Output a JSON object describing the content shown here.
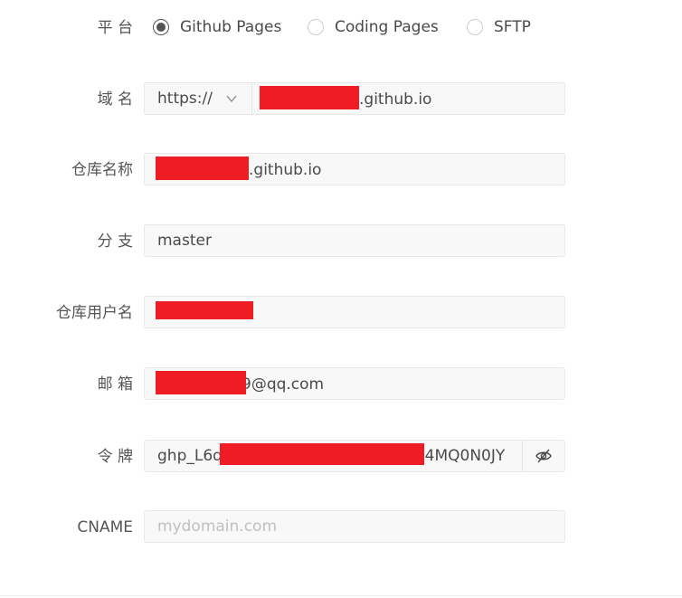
{
  "platform": {
    "label": "平 台",
    "options": [
      {
        "label": "Github Pages",
        "selected": true
      },
      {
        "label": "Coding Pages",
        "selected": false
      },
      {
        "label": "SFTP",
        "selected": false
      }
    ]
  },
  "domain": {
    "label": "域 名",
    "protocol": "https://",
    "suffix": ".github.io"
  },
  "repo_name": {
    "label": "仓库名称",
    "suffix": ".github.io"
  },
  "branch": {
    "label": "分 支",
    "value": "master"
  },
  "repo_user": {
    "label": "仓库用户名"
  },
  "email": {
    "label": "邮 箱",
    "suffix": "9@qq.com"
  },
  "token": {
    "label": "令 牌",
    "prefix": "ghp_L6q",
    "suffix": "l4MQ0N0JY"
  },
  "cname": {
    "label": "CNAME",
    "placeholder": "mydomain.com"
  },
  "colors": {
    "redaction": "#f01c24",
    "field_bg": "#f8f8f8",
    "border": "#e7e7e7",
    "text": "#4a4a4a"
  },
  "icons": {
    "chevron": "chevron-down-icon",
    "eye": "eye-off-icon"
  }
}
